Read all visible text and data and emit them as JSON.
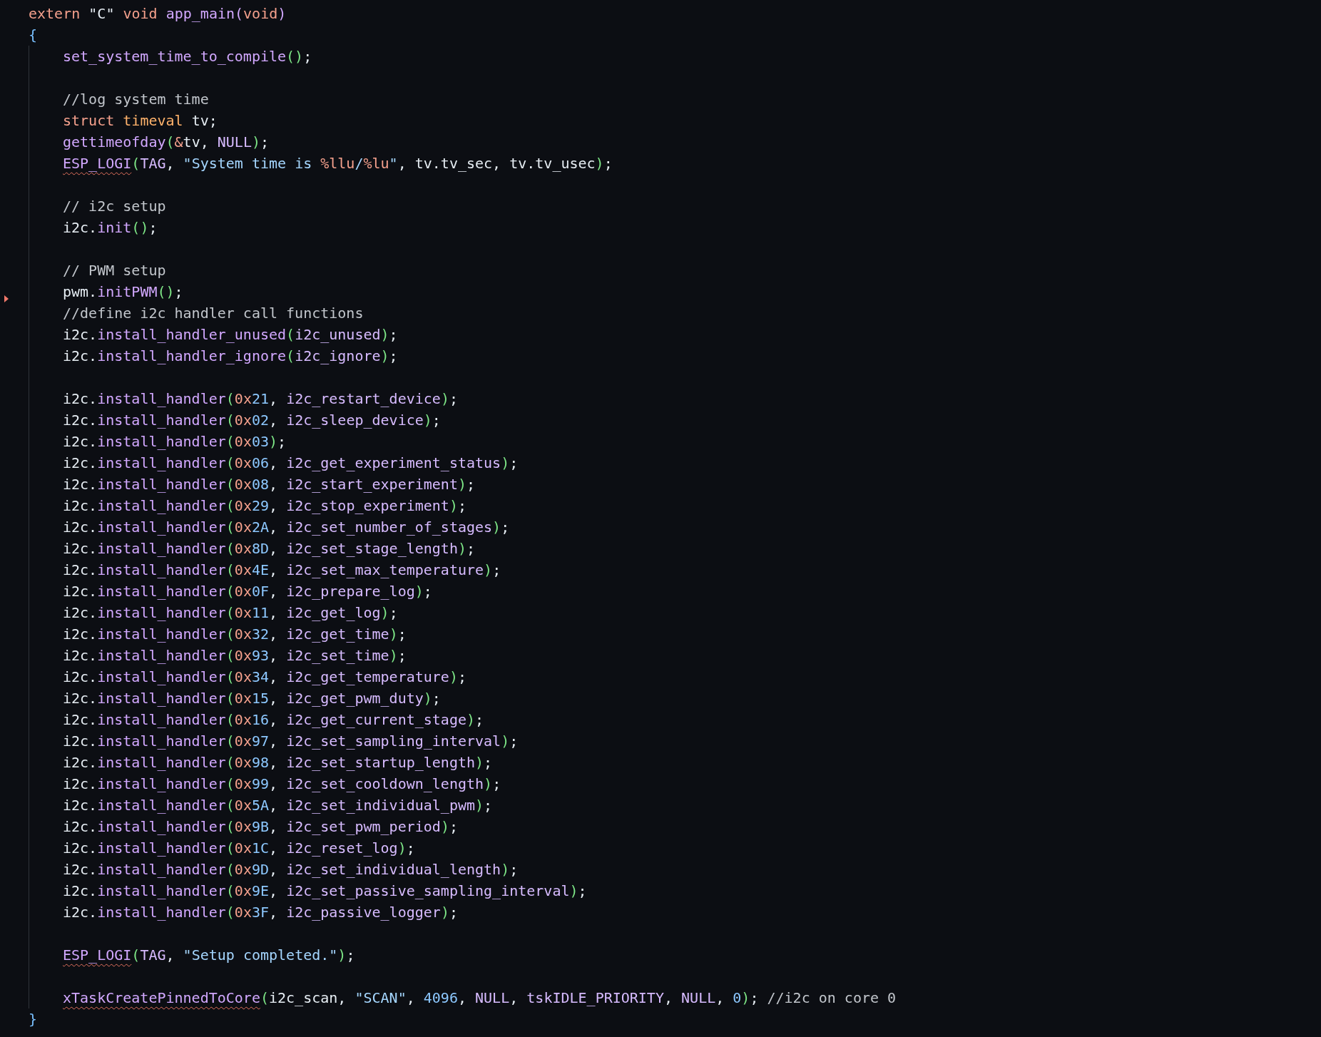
{
  "editor": {
    "signature": [
      {
        "kind": "keyword",
        "text": "extern "
      },
      {
        "kind": "plain",
        "text": "\"C\" "
      },
      {
        "kind": "keyword",
        "text": "void "
      },
      {
        "kind": "function",
        "text": "app_main"
      },
      {
        "kind": "function",
        "text": "("
      },
      {
        "kind": "keyword",
        "text": "void"
      },
      {
        "kind": "function",
        "text": ")"
      }
    ],
    "open_brace": "{",
    "body": [
      {
        "lines": [
          {
            "tokens": [
              {
                "kind": "function",
                "text": "set_system_time_to_compile"
              },
              {
                "kind": "paren",
                "text": "()"
              },
              {
                "kind": "plain",
                "text": ";"
              }
            ]
          }
        ]
      },
      {
        "lines": [
          {
            "tokens": [
              {
                "kind": "comment",
                "text": "//log system time"
              }
            ]
          },
          {
            "tokens": [
              {
                "kind": "keyword",
                "text": "struct "
              },
              {
                "kind": "type",
                "text": "timeval"
              },
              {
                "kind": "plain",
                "text": " tv;"
              }
            ]
          },
          {
            "tokens": [
              {
                "kind": "function",
                "text": "gettimeofday"
              },
              {
                "kind": "paren",
                "text": "("
              },
              {
                "kind": "keyword",
                "text": "&"
              },
              {
                "kind": "plain",
                "text": "tv, "
              },
              {
                "kind": "constant",
                "text": "NULL"
              },
              {
                "kind": "paren",
                "text": ")"
              },
              {
                "kind": "plain",
                "text": ";"
              }
            ]
          },
          {
            "tokens": [
              {
                "kind": "function",
                "text": "ESP_LOGI",
                "squiggle": true
              },
              {
                "kind": "paren",
                "text": "("
              },
              {
                "kind": "constant",
                "text": "TAG"
              },
              {
                "kind": "plain",
                "text": ", "
              },
              {
                "kind": "string",
                "text": "\"System time is "
              },
              {
                "kind": "keyword",
                "text": "%llu"
              },
              {
                "kind": "string",
                "text": "/"
              },
              {
                "kind": "keyword",
                "text": "%lu"
              },
              {
                "kind": "string",
                "text": "\""
              },
              {
                "kind": "plain",
                "text": ", tv.tv_sec, tv.tv_usec"
              },
              {
                "kind": "paren",
                "text": ")"
              },
              {
                "kind": "plain",
                "text": ";"
              }
            ]
          }
        ]
      },
      {
        "lines": [
          {
            "tokens": [
              {
                "kind": "comment",
                "text": "// i2c setup"
              }
            ]
          },
          {
            "tokens": [
              {
                "kind": "plain",
                "text": "i2c."
              },
              {
                "kind": "function",
                "text": "init"
              },
              {
                "kind": "paren",
                "text": "()"
              },
              {
                "kind": "plain",
                "text": ";"
              }
            ]
          }
        ]
      },
      {
        "lines": [
          {
            "tokens": [
              {
                "kind": "comment",
                "text": "// PWM setup"
              }
            ]
          },
          {
            "deleted_marker": true,
            "tokens": [
              {
                "kind": "plain",
                "text": "pwm."
              },
              {
                "kind": "function",
                "text": "initPWM"
              },
              {
                "kind": "paren",
                "text": "()"
              },
              {
                "kind": "plain",
                "text": ";"
              }
            ]
          },
          {
            "tokens": [
              {
                "kind": "comment",
                "text": "//define i2c handler call functions"
              }
            ]
          },
          {
            "tokens": [
              {
                "kind": "plain",
                "text": "i2c."
              },
              {
                "kind": "function",
                "text": "install_handler_unused"
              },
              {
                "kind": "paren",
                "text": "("
              },
              {
                "kind": "variable",
                "text": "i2c_unused"
              },
              {
                "kind": "paren",
                "text": ")"
              },
              {
                "kind": "plain",
                "text": ";"
              }
            ]
          },
          {
            "tokens": [
              {
                "kind": "plain",
                "text": "i2c."
              },
              {
                "kind": "function",
                "text": "install_handler_ignore"
              },
              {
                "kind": "paren",
                "text": "("
              },
              {
                "kind": "variable",
                "text": "i2c_ignore"
              },
              {
                "kind": "paren",
                "text": ")"
              },
              {
                "kind": "plain",
                "text": ";"
              }
            ]
          }
        ]
      },
      {
        "lines": [
          {
            "tokens": [
              {
                "kind": "plain",
                "text": "i2c."
              },
              {
                "kind": "function",
                "text": "install_handler"
              },
              {
                "kind": "paren",
                "text": "("
              },
              {
                "kind": "keyword",
                "text": "0x"
              },
              {
                "kind": "number",
                "text": "21"
              },
              {
                "kind": "plain",
                "text": ", "
              },
              {
                "kind": "variable",
                "text": "i2c_restart_device"
              },
              {
                "kind": "paren",
                "text": ")"
              },
              {
                "kind": "plain",
                "text": ";"
              }
            ]
          },
          {
            "tokens": [
              {
                "kind": "plain",
                "text": "i2c."
              },
              {
                "kind": "function",
                "text": "install_handler"
              },
              {
                "kind": "paren",
                "text": "("
              },
              {
                "kind": "keyword",
                "text": "0x"
              },
              {
                "kind": "number",
                "text": "02"
              },
              {
                "kind": "plain",
                "text": ", "
              },
              {
                "kind": "variable",
                "text": "i2c_sleep_device"
              },
              {
                "kind": "paren",
                "text": ")"
              },
              {
                "kind": "plain",
                "text": ";"
              }
            ]
          },
          {
            "tokens": [
              {
                "kind": "plain",
                "text": "i2c."
              },
              {
                "kind": "function",
                "text": "install_handler"
              },
              {
                "kind": "paren",
                "text": "("
              },
              {
                "kind": "keyword",
                "text": "0x"
              },
              {
                "kind": "number",
                "text": "03"
              },
              {
                "kind": "paren",
                "text": ")"
              },
              {
                "kind": "plain",
                "text": ";"
              }
            ]
          },
          {
            "tokens": [
              {
                "kind": "plain",
                "text": "i2c."
              },
              {
                "kind": "function",
                "text": "install_handler"
              },
              {
                "kind": "paren",
                "text": "("
              },
              {
                "kind": "keyword",
                "text": "0x"
              },
              {
                "kind": "number",
                "text": "06"
              },
              {
                "kind": "plain",
                "text": ", "
              },
              {
                "kind": "variable",
                "text": "i2c_get_experiment_status"
              },
              {
                "kind": "paren",
                "text": ")"
              },
              {
                "kind": "plain",
                "text": ";"
              }
            ]
          },
          {
            "tokens": [
              {
                "kind": "plain",
                "text": "i2c."
              },
              {
                "kind": "function",
                "text": "install_handler"
              },
              {
                "kind": "paren",
                "text": "("
              },
              {
                "kind": "keyword",
                "text": "0x"
              },
              {
                "kind": "number",
                "text": "08"
              },
              {
                "kind": "plain",
                "text": ", "
              },
              {
                "kind": "variable",
                "text": "i2c_start_experiment"
              },
              {
                "kind": "paren",
                "text": ")"
              },
              {
                "kind": "plain",
                "text": ";"
              }
            ]
          },
          {
            "tokens": [
              {
                "kind": "plain",
                "text": "i2c."
              },
              {
                "kind": "function",
                "text": "install_handler"
              },
              {
                "kind": "paren",
                "text": "("
              },
              {
                "kind": "keyword",
                "text": "0x"
              },
              {
                "kind": "number",
                "text": "29"
              },
              {
                "kind": "plain",
                "text": ", "
              },
              {
                "kind": "variable",
                "text": "i2c_stop_experiment"
              },
              {
                "kind": "paren",
                "text": ")"
              },
              {
                "kind": "plain",
                "text": ";"
              }
            ]
          },
          {
            "tokens": [
              {
                "kind": "plain",
                "text": "i2c."
              },
              {
                "kind": "function",
                "text": "install_handler"
              },
              {
                "kind": "paren",
                "text": "("
              },
              {
                "kind": "keyword",
                "text": "0x"
              },
              {
                "kind": "number",
                "text": "2A"
              },
              {
                "kind": "plain",
                "text": ", "
              },
              {
                "kind": "variable",
                "text": "i2c_set_number_of_stages"
              },
              {
                "kind": "paren",
                "text": ")"
              },
              {
                "kind": "plain",
                "text": ";"
              }
            ]
          },
          {
            "tokens": [
              {
                "kind": "plain",
                "text": "i2c."
              },
              {
                "kind": "function",
                "text": "install_handler"
              },
              {
                "kind": "paren",
                "text": "("
              },
              {
                "kind": "keyword",
                "text": "0x"
              },
              {
                "kind": "number",
                "text": "8D"
              },
              {
                "kind": "plain",
                "text": ", "
              },
              {
                "kind": "variable",
                "text": "i2c_set_stage_length"
              },
              {
                "kind": "paren",
                "text": ")"
              },
              {
                "kind": "plain",
                "text": ";"
              }
            ]
          },
          {
            "tokens": [
              {
                "kind": "plain",
                "text": "i2c."
              },
              {
                "kind": "function",
                "text": "install_handler"
              },
              {
                "kind": "paren",
                "text": "("
              },
              {
                "kind": "keyword",
                "text": "0x"
              },
              {
                "kind": "number",
                "text": "4E"
              },
              {
                "kind": "plain",
                "text": ", "
              },
              {
                "kind": "variable",
                "text": "i2c_set_max_temperature"
              },
              {
                "kind": "paren",
                "text": ")"
              },
              {
                "kind": "plain",
                "text": ";"
              }
            ]
          },
          {
            "tokens": [
              {
                "kind": "plain",
                "text": "i2c."
              },
              {
                "kind": "function",
                "text": "install_handler"
              },
              {
                "kind": "paren",
                "text": "("
              },
              {
                "kind": "keyword",
                "text": "0x"
              },
              {
                "kind": "number",
                "text": "0F"
              },
              {
                "kind": "plain",
                "text": ", "
              },
              {
                "kind": "variable",
                "text": "i2c_prepare_log"
              },
              {
                "kind": "paren",
                "text": ")"
              },
              {
                "kind": "plain",
                "text": ";"
              }
            ]
          },
          {
            "tokens": [
              {
                "kind": "plain",
                "text": "i2c."
              },
              {
                "kind": "function",
                "text": "install_handler"
              },
              {
                "kind": "paren",
                "text": "("
              },
              {
                "kind": "keyword",
                "text": "0x"
              },
              {
                "kind": "number",
                "text": "11"
              },
              {
                "kind": "plain",
                "text": ", "
              },
              {
                "kind": "variable",
                "text": "i2c_get_log"
              },
              {
                "kind": "paren",
                "text": ")"
              },
              {
                "kind": "plain",
                "text": ";"
              }
            ]
          },
          {
            "tokens": [
              {
                "kind": "plain",
                "text": "i2c."
              },
              {
                "kind": "function",
                "text": "install_handler"
              },
              {
                "kind": "paren",
                "text": "("
              },
              {
                "kind": "keyword",
                "text": "0x"
              },
              {
                "kind": "number",
                "text": "32"
              },
              {
                "kind": "plain",
                "text": ", "
              },
              {
                "kind": "variable",
                "text": "i2c_get_time"
              },
              {
                "kind": "paren",
                "text": ")"
              },
              {
                "kind": "plain",
                "text": ";"
              }
            ]
          },
          {
            "tokens": [
              {
                "kind": "plain",
                "text": "i2c."
              },
              {
                "kind": "function",
                "text": "install_handler"
              },
              {
                "kind": "paren",
                "text": "("
              },
              {
                "kind": "keyword",
                "text": "0x"
              },
              {
                "kind": "number",
                "text": "93"
              },
              {
                "kind": "plain",
                "text": ", "
              },
              {
                "kind": "variable",
                "text": "i2c_set_time"
              },
              {
                "kind": "paren",
                "text": ")"
              },
              {
                "kind": "plain",
                "text": ";"
              }
            ]
          },
          {
            "tokens": [
              {
                "kind": "plain",
                "text": "i2c."
              },
              {
                "kind": "function",
                "text": "install_handler"
              },
              {
                "kind": "paren",
                "text": "("
              },
              {
                "kind": "keyword",
                "text": "0x"
              },
              {
                "kind": "number",
                "text": "34"
              },
              {
                "kind": "plain",
                "text": ", "
              },
              {
                "kind": "variable",
                "text": "i2c_get_temperature"
              },
              {
                "kind": "paren",
                "text": ")"
              },
              {
                "kind": "plain",
                "text": ";"
              }
            ]
          },
          {
            "tokens": [
              {
                "kind": "plain",
                "text": "i2c."
              },
              {
                "kind": "function",
                "text": "install_handler"
              },
              {
                "kind": "paren",
                "text": "("
              },
              {
                "kind": "keyword",
                "text": "0x"
              },
              {
                "kind": "number",
                "text": "15"
              },
              {
                "kind": "plain",
                "text": ", "
              },
              {
                "kind": "variable",
                "text": "i2c_get_pwm_duty"
              },
              {
                "kind": "paren",
                "text": ")"
              },
              {
                "kind": "plain",
                "text": ";"
              }
            ]
          },
          {
            "tokens": [
              {
                "kind": "plain",
                "text": "i2c."
              },
              {
                "kind": "function",
                "text": "install_handler"
              },
              {
                "kind": "paren",
                "text": "("
              },
              {
                "kind": "keyword",
                "text": "0x"
              },
              {
                "kind": "number",
                "text": "16"
              },
              {
                "kind": "plain",
                "text": ", "
              },
              {
                "kind": "variable",
                "text": "i2c_get_current_stage"
              },
              {
                "kind": "paren",
                "text": ")"
              },
              {
                "kind": "plain",
                "text": ";"
              }
            ]
          },
          {
            "tokens": [
              {
                "kind": "plain",
                "text": "i2c."
              },
              {
                "kind": "function",
                "text": "install_handler"
              },
              {
                "kind": "paren",
                "text": "("
              },
              {
                "kind": "keyword",
                "text": "0x"
              },
              {
                "kind": "number",
                "text": "97"
              },
              {
                "kind": "plain",
                "text": ", "
              },
              {
                "kind": "variable",
                "text": "i2c_set_sampling_interval"
              },
              {
                "kind": "paren",
                "text": ")"
              },
              {
                "kind": "plain",
                "text": ";"
              }
            ]
          },
          {
            "tokens": [
              {
                "kind": "plain",
                "text": "i2c."
              },
              {
                "kind": "function",
                "text": "install_handler"
              },
              {
                "kind": "paren",
                "text": "("
              },
              {
                "kind": "keyword",
                "text": "0x"
              },
              {
                "kind": "number",
                "text": "98"
              },
              {
                "kind": "plain",
                "text": ", "
              },
              {
                "kind": "variable",
                "text": "i2c_set_startup_length"
              },
              {
                "kind": "paren",
                "text": ")"
              },
              {
                "kind": "plain",
                "text": ";"
              }
            ]
          },
          {
            "tokens": [
              {
                "kind": "plain",
                "text": "i2c."
              },
              {
                "kind": "function",
                "text": "install_handler"
              },
              {
                "kind": "paren",
                "text": "("
              },
              {
                "kind": "keyword",
                "text": "0x"
              },
              {
                "kind": "number",
                "text": "99"
              },
              {
                "kind": "plain",
                "text": ", "
              },
              {
                "kind": "variable",
                "text": "i2c_set_cooldown_length"
              },
              {
                "kind": "paren",
                "text": ")"
              },
              {
                "kind": "plain",
                "text": ";"
              }
            ]
          },
          {
            "tokens": [
              {
                "kind": "plain",
                "text": "i2c."
              },
              {
                "kind": "function",
                "text": "install_handler"
              },
              {
                "kind": "paren",
                "text": "("
              },
              {
                "kind": "keyword",
                "text": "0x"
              },
              {
                "kind": "number",
                "text": "5A"
              },
              {
                "kind": "plain",
                "text": ", "
              },
              {
                "kind": "variable",
                "text": "i2c_set_individual_pwm"
              },
              {
                "kind": "paren",
                "text": ")"
              },
              {
                "kind": "plain",
                "text": ";"
              }
            ]
          },
          {
            "tokens": [
              {
                "kind": "plain",
                "text": "i2c."
              },
              {
                "kind": "function",
                "text": "install_handler"
              },
              {
                "kind": "paren",
                "text": "("
              },
              {
                "kind": "keyword",
                "text": "0x"
              },
              {
                "kind": "number",
                "text": "9B"
              },
              {
                "kind": "plain",
                "text": ", "
              },
              {
                "kind": "variable",
                "text": "i2c_set_pwm_period"
              },
              {
                "kind": "paren",
                "text": ")"
              },
              {
                "kind": "plain",
                "text": ";"
              }
            ]
          },
          {
            "tokens": [
              {
                "kind": "plain",
                "text": "i2c."
              },
              {
                "kind": "function",
                "text": "install_handler"
              },
              {
                "kind": "paren",
                "text": "("
              },
              {
                "kind": "keyword",
                "text": "0x"
              },
              {
                "kind": "number",
                "text": "1C"
              },
              {
                "kind": "plain",
                "text": ", "
              },
              {
                "kind": "variable",
                "text": "i2c_reset_log"
              },
              {
                "kind": "paren",
                "text": ")"
              },
              {
                "kind": "plain",
                "text": ";"
              }
            ]
          },
          {
            "tokens": [
              {
                "kind": "plain",
                "text": "i2c."
              },
              {
                "kind": "function",
                "text": "install_handler"
              },
              {
                "kind": "paren",
                "text": "("
              },
              {
                "kind": "keyword",
                "text": "0x"
              },
              {
                "kind": "number",
                "text": "9D"
              },
              {
                "kind": "plain",
                "text": ", "
              },
              {
                "kind": "variable",
                "text": "i2c_set_individual_length"
              },
              {
                "kind": "paren",
                "text": ")"
              },
              {
                "kind": "plain",
                "text": ";"
              }
            ]
          },
          {
            "tokens": [
              {
                "kind": "plain",
                "text": "i2c."
              },
              {
                "kind": "function",
                "text": "install_handler"
              },
              {
                "kind": "paren",
                "text": "("
              },
              {
                "kind": "keyword",
                "text": "0x"
              },
              {
                "kind": "number",
                "text": "9E"
              },
              {
                "kind": "plain",
                "text": ", "
              },
              {
                "kind": "variable",
                "text": "i2c_set_passive_sampling_interval"
              },
              {
                "kind": "paren",
                "text": ")"
              },
              {
                "kind": "plain",
                "text": ";"
              }
            ]
          },
          {
            "tokens": [
              {
                "kind": "plain",
                "text": "i2c."
              },
              {
                "kind": "function",
                "text": "install_handler"
              },
              {
                "kind": "paren",
                "text": "("
              },
              {
                "kind": "keyword",
                "text": "0x"
              },
              {
                "kind": "number",
                "text": "3F"
              },
              {
                "kind": "plain",
                "text": ", "
              },
              {
                "kind": "variable",
                "text": "i2c_passive_logger"
              },
              {
                "kind": "paren",
                "text": ")"
              },
              {
                "kind": "plain",
                "text": ";"
              }
            ]
          }
        ]
      },
      {
        "lines": [
          {
            "tokens": [
              {
                "kind": "function",
                "text": "ESP_LOGI",
                "squiggle": true
              },
              {
                "kind": "paren",
                "text": "("
              },
              {
                "kind": "constant",
                "text": "TAG"
              },
              {
                "kind": "plain",
                "text": ", "
              },
              {
                "kind": "string",
                "text": "\"Setup completed.\""
              },
              {
                "kind": "paren",
                "text": ")"
              },
              {
                "kind": "plain",
                "text": ";"
              }
            ]
          }
        ]
      },
      {
        "lines": [
          {
            "tokens": [
              {
                "kind": "function",
                "text": "xTaskCreatePinnedToCore",
                "squiggle": true
              },
              {
                "kind": "paren",
                "text": "("
              },
              {
                "kind": "plain",
                "text": "i2c_scan, "
              },
              {
                "kind": "string",
                "text": "\"SCAN\""
              },
              {
                "kind": "plain",
                "text": ", "
              },
              {
                "kind": "number",
                "text": "4096"
              },
              {
                "kind": "plain",
                "text": ", "
              },
              {
                "kind": "constant",
                "text": "NULL"
              },
              {
                "kind": "plain",
                "text": ", "
              },
              {
                "kind": "constant",
                "text": "tskIDLE_PRIORITY"
              },
              {
                "kind": "plain",
                "text": ", "
              },
              {
                "kind": "constant",
                "text": "NULL"
              },
              {
                "kind": "plain",
                "text": ", "
              },
              {
                "kind": "number",
                "text": "0"
              },
              {
                "kind": "paren",
                "text": ")"
              },
              {
                "kind": "plain",
                "text": "; "
              },
              {
                "kind": "comment",
                "text": "//i2c on core 0"
              }
            ]
          }
        ]
      }
    ],
    "close_brace": "}"
  }
}
